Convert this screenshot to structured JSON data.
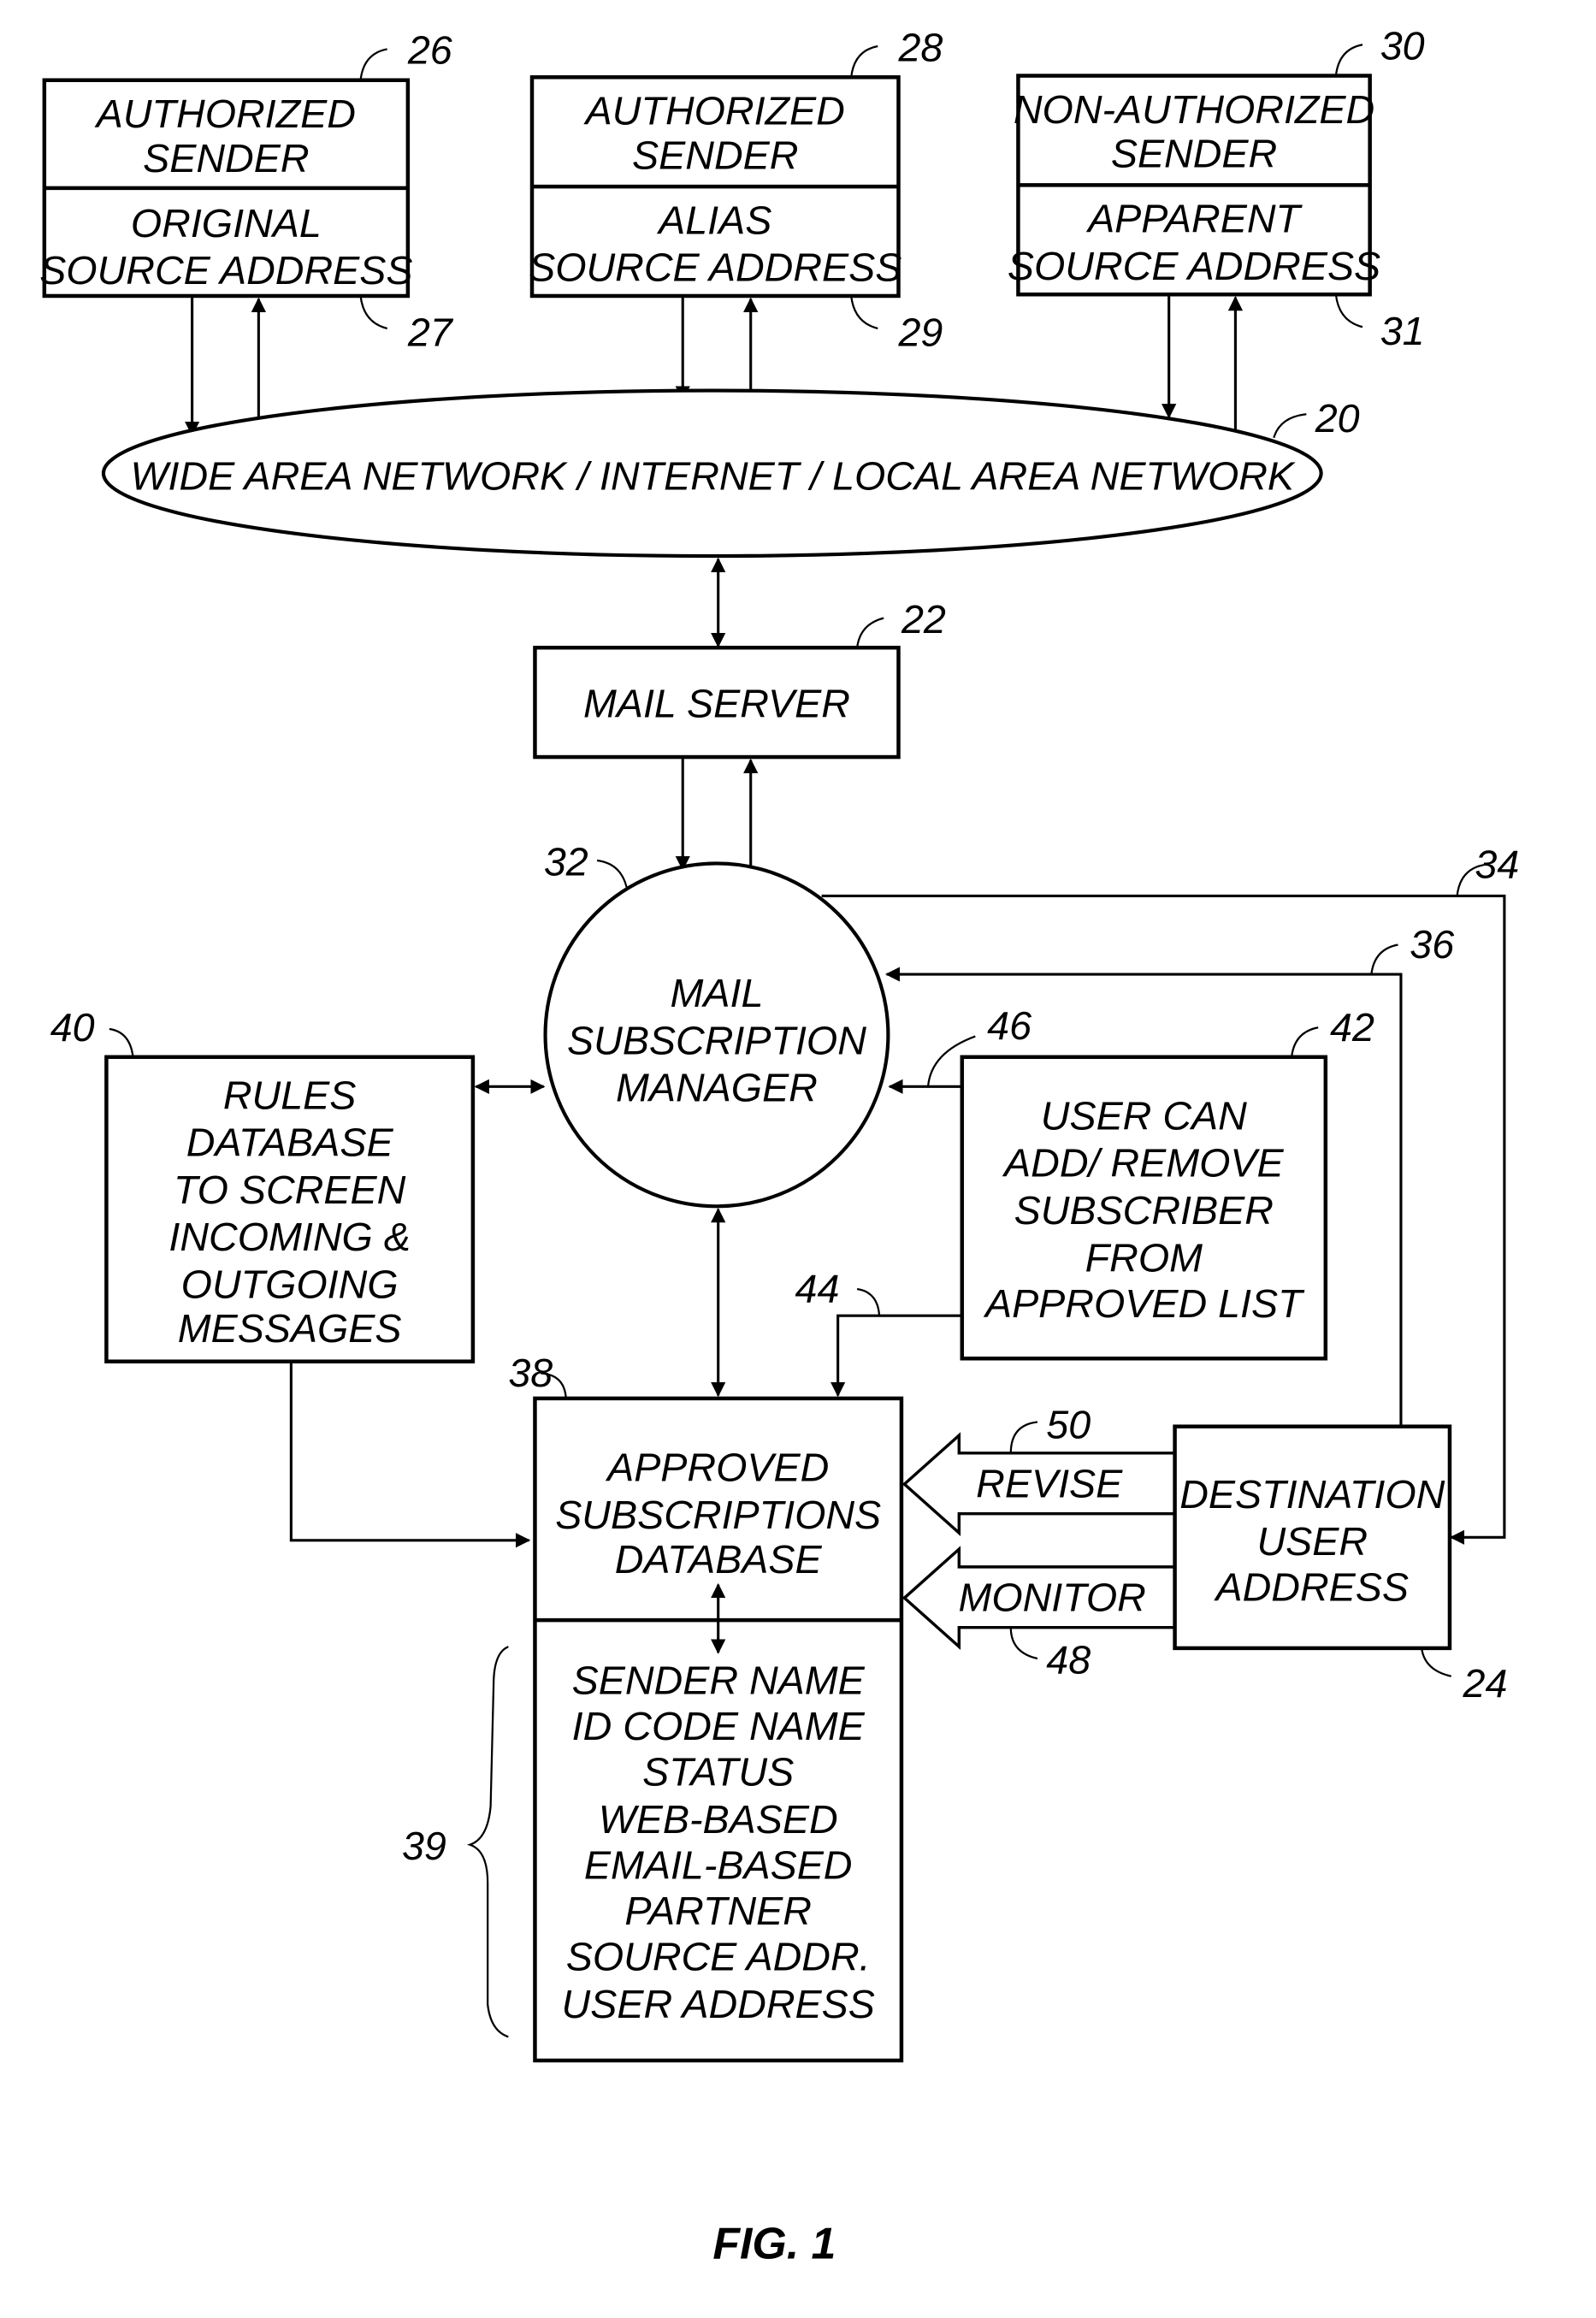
{
  "figure_label": "FIG. 1",
  "nodes": {
    "sender_authorized_original": {
      "ref": "26",
      "ref_bottom": "27",
      "title": [
        "AUTHORIZED",
        "SENDER"
      ],
      "body": [
        "ORIGINAL",
        "SOURCE ADDRESS"
      ]
    },
    "sender_authorized_alias": {
      "ref": "28",
      "ref_bottom": "29",
      "title": [
        "AUTHORIZED",
        "SENDER"
      ],
      "body": [
        "ALIAS",
        "SOURCE ADDRESS"
      ]
    },
    "sender_non_authorized": {
      "ref": "30",
      "ref_bottom": "31",
      "title": [
        "NON-AUTHORIZED",
        "SENDER"
      ],
      "body": [
        "APPARENT",
        "SOURCE ADDRESS"
      ]
    },
    "network": {
      "ref": "20",
      "label": "WIDE AREA NETWORK / INTERNET / LOCAL AREA NETWORK"
    },
    "mail_server": {
      "ref": "22",
      "label": "MAIL SERVER"
    },
    "subscription_manager": {
      "ref": "32",
      "lines": [
        "MAIL",
        "SUBSCRIPTION",
        "MANAGER"
      ]
    },
    "rules_database": {
      "ref": "40",
      "lines": [
        "RULES",
        "DATABASE",
        "TO SCREEN",
        "INCOMING &",
        "OUTGOING",
        "MESSAGES"
      ]
    },
    "user_list_control": {
      "ref": "42",
      "lines": [
        "USER CAN",
        "ADD/ REMOVE",
        "SUBSCRIBER",
        "FROM",
        "APPROVED LIST"
      ]
    },
    "approved_db": {
      "ref": "38",
      "lines": [
        "APPROVED",
        "SUBSCRIPTIONS",
        "DATABASE"
      ]
    },
    "approved_db_fields": {
      "ref": "39",
      "lines": [
        "SENDER NAME",
        "ID CODE NAME",
        "STATUS",
        "WEB-BASED",
        "EMAIL-BASED",
        "PARTNER",
        "SOURCE ADDR.",
        "USER ADDRESS"
      ]
    },
    "destination": {
      "ref": "24",
      "lines": [
        "DESTINATION",
        "USER",
        "ADDRESS"
      ]
    }
  },
  "connections": {
    "line_34": {
      "ref": "34"
    },
    "line_36": {
      "ref": "36"
    },
    "arrow_44": {
      "ref": "44"
    },
    "arrow_46": {
      "ref": "46"
    },
    "revise": {
      "ref": "50",
      "label": "REVISE"
    },
    "monitor": {
      "ref": "48",
      "label": "MONITOR"
    }
  }
}
